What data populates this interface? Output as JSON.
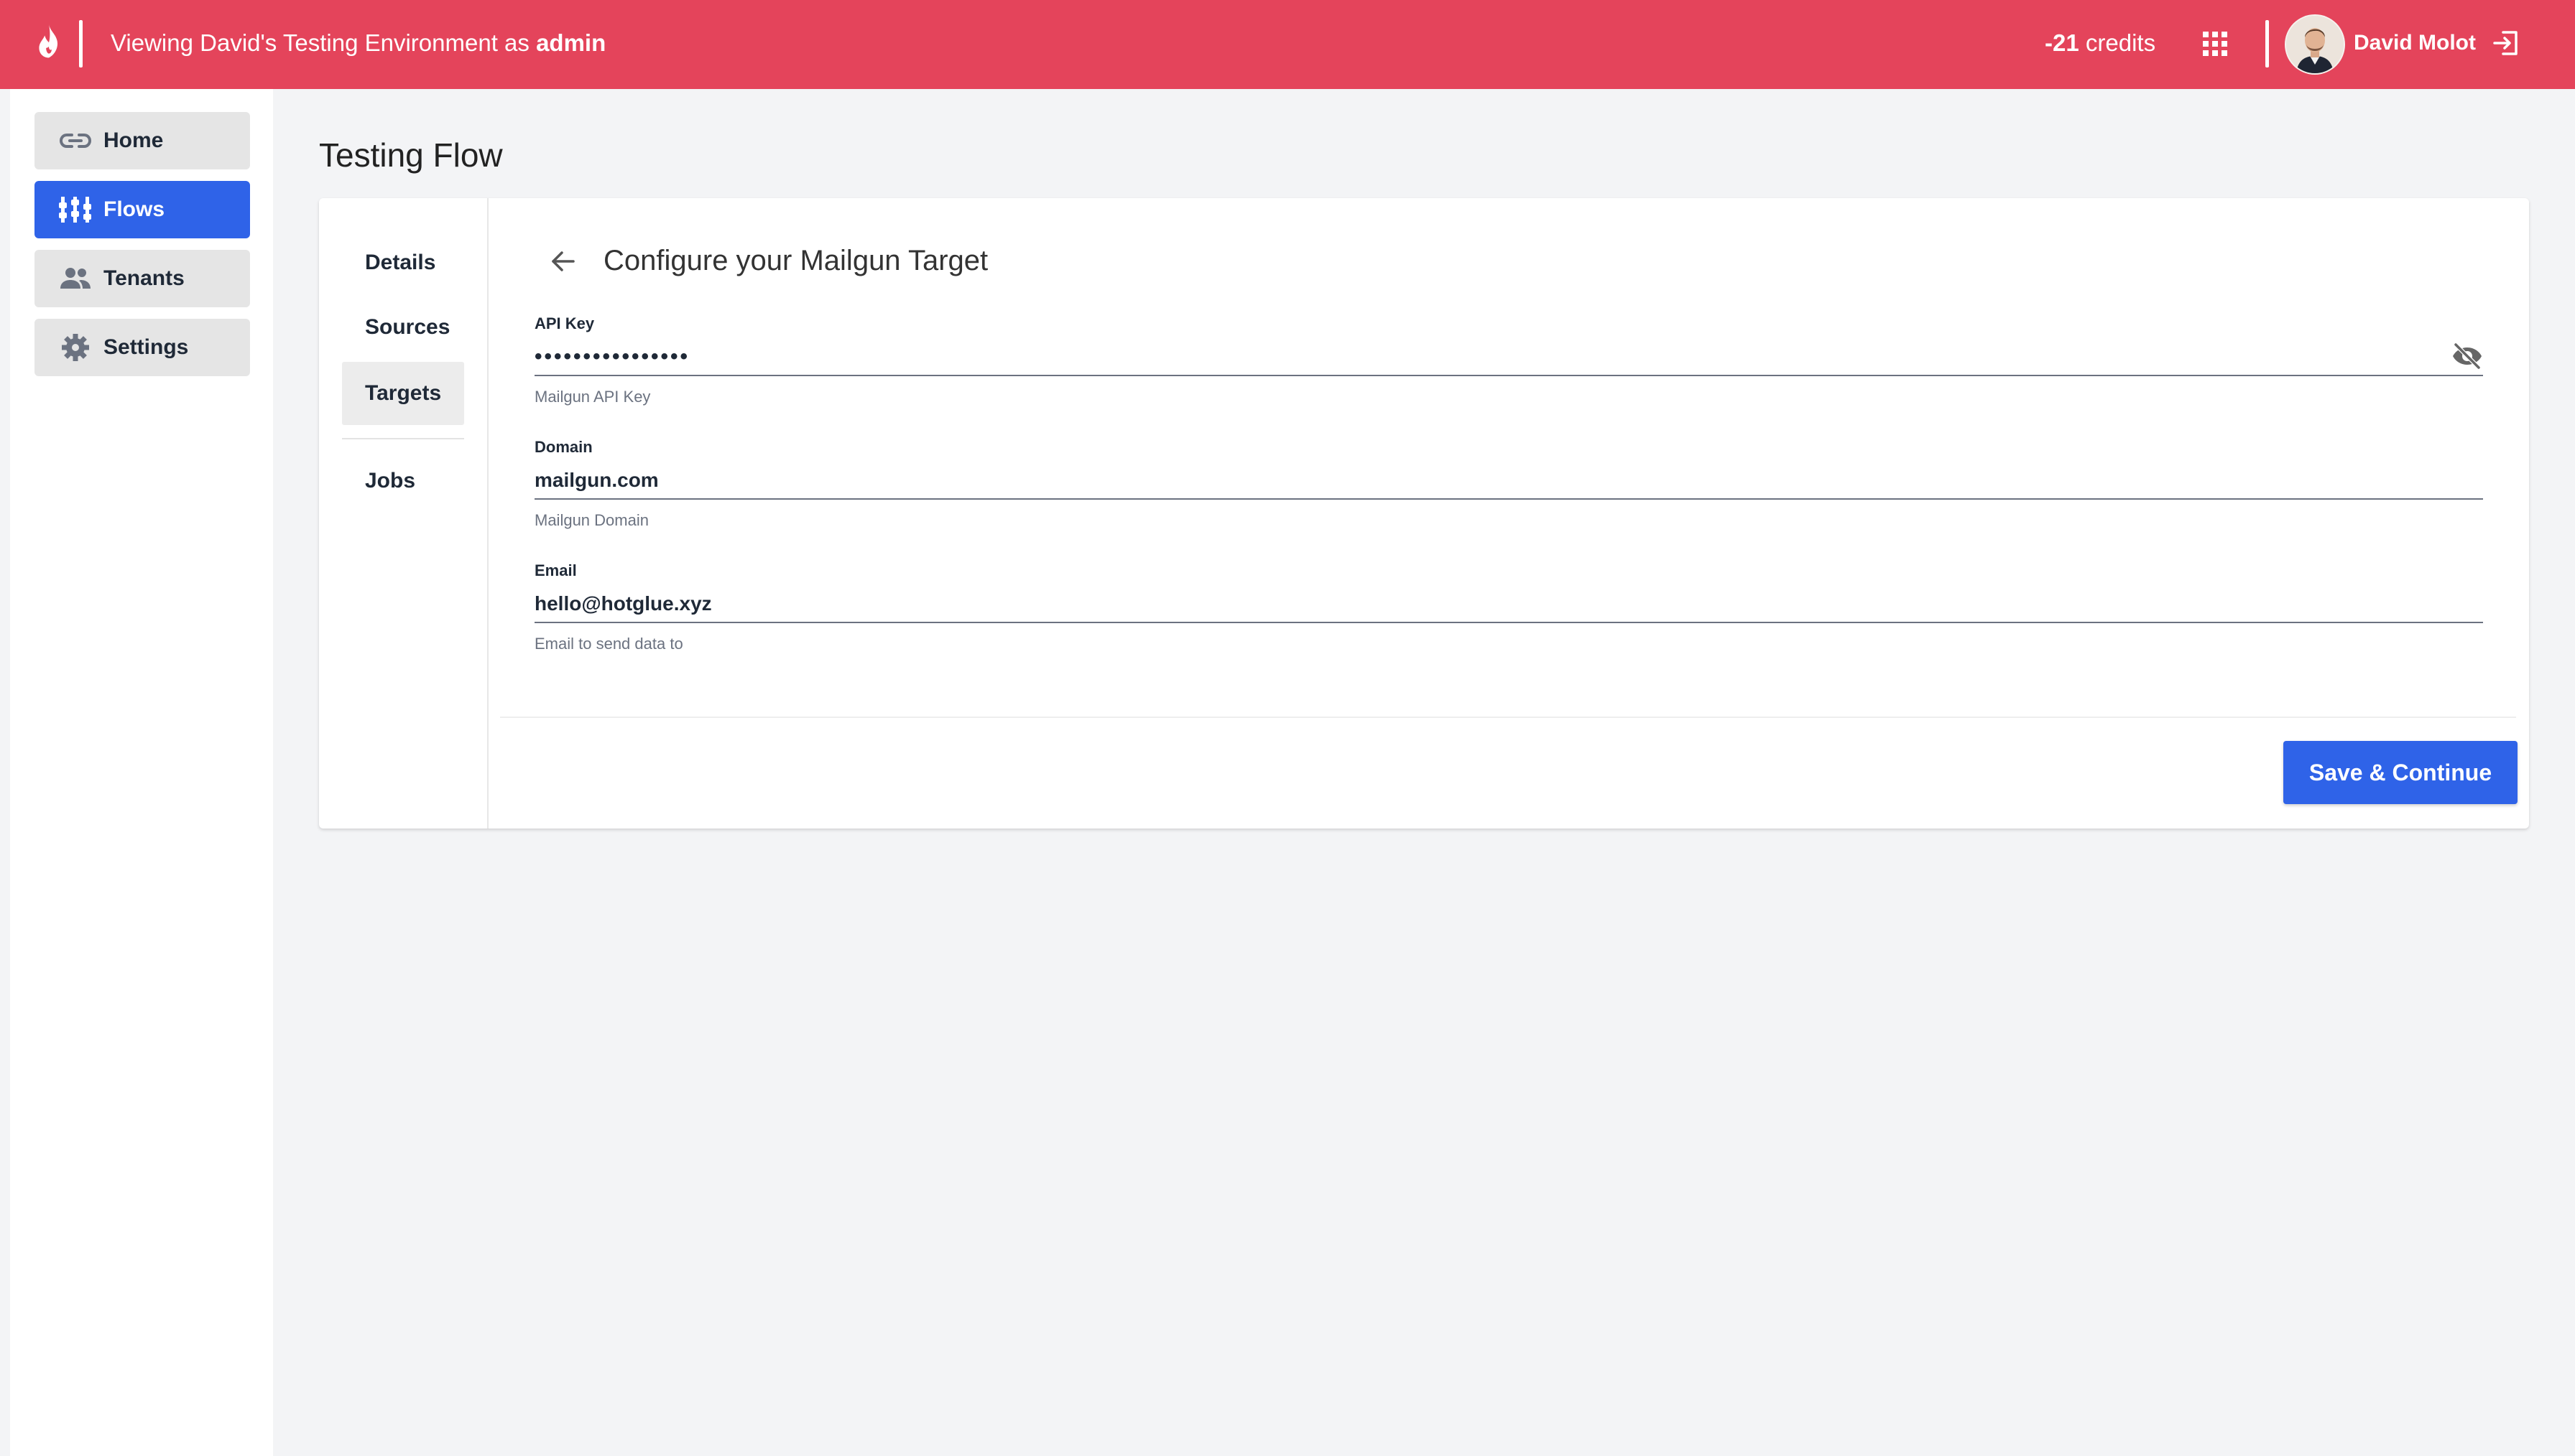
{
  "header": {
    "env_prefix": "Viewing David's Testing Environment as",
    "role": "admin",
    "credits_value": "-21",
    "credits_label": "credits",
    "user_name": "David Molot",
    "brand_color": "#e4445b",
    "logo_icon": "flame-icon",
    "apps_icon": "grid-icon",
    "logout_icon": "logout-icon"
  },
  "sidebar": {
    "items": [
      {
        "label": "Home",
        "icon": "link-icon",
        "active": false
      },
      {
        "label": "Flows",
        "icon": "flows-icon",
        "active": true
      },
      {
        "label": "Tenants",
        "icon": "people-icon",
        "active": false
      },
      {
        "label": "Settings",
        "icon": "gear-icon",
        "active": false
      }
    ],
    "active_color": "#2f63e8"
  },
  "page": {
    "title": "Testing Flow"
  },
  "flow_nav": {
    "tabs": [
      {
        "label": "Details",
        "active": false
      },
      {
        "label": "Sources",
        "active": false
      },
      {
        "label": "Targets",
        "active": true
      },
      {
        "label": "Jobs",
        "active": false
      }
    ]
  },
  "form": {
    "title": "Configure your Mailgun Target",
    "fields": [
      {
        "label": "API Key",
        "value": "••••••••••••••••",
        "help": "Mailgun API Key",
        "type": "password"
      },
      {
        "label": "Domain",
        "value": "mailgun.com",
        "help": "Mailgun Domain",
        "type": "text"
      },
      {
        "label": "Email",
        "value": "hello@hotglue.xyz",
        "help": "Email to send data to",
        "type": "text"
      }
    ],
    "submit_label": "Save & Continue"
  }
}
